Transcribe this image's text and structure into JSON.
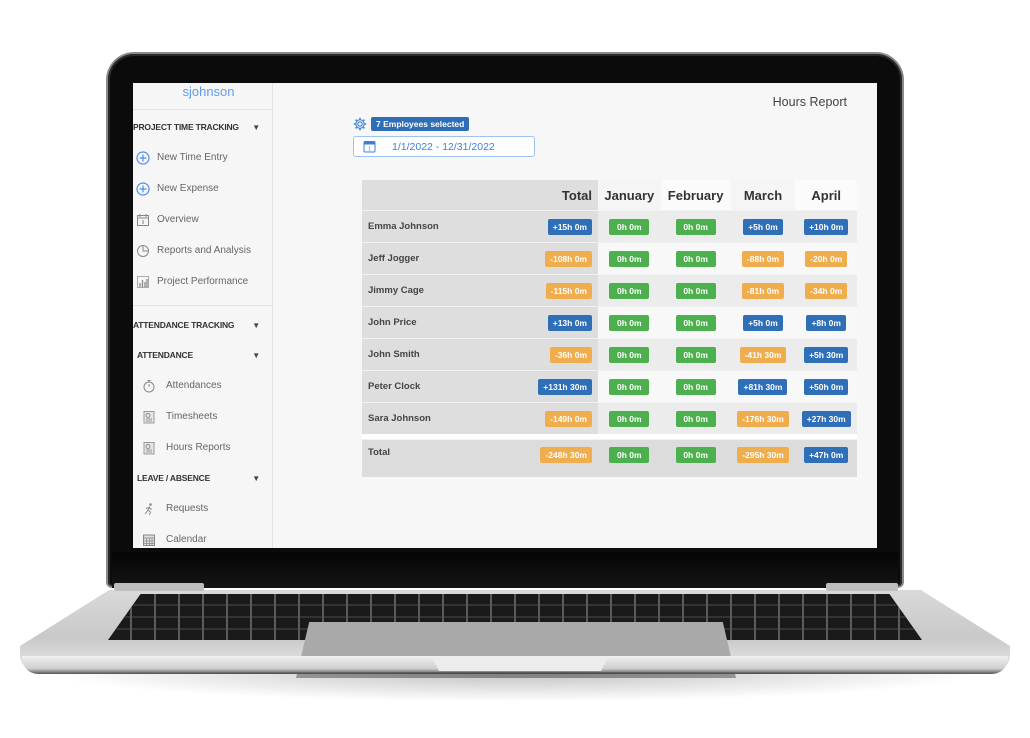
{
  "sidebar": {
    "username": "sjohnson",
    "sections": {
      "project_time_tracking": {
        "label": "PROJECT TIME TRACKING",
        "items": [
          {
            "label": "New Time Entry",
            "icon": "plus-circle-icon"
          },
          {
            "label": "New Expense",
            "icon": "plus-circle-icon"
          },
          {
            "label": "Overview",
            "icon": "calendar-icon"
          },
          {
            "label": "Reports and Analysis",
            "icon": "pie-chart-icon"
          },
          {
            "label": "Project Performance",
            "icon": "bar-chart-icon"
          }
        ]
      },
      "attendance_tracking": {
        "label": "ATTENDANCE TRACKING"
      },
      "attendance": {
        "label": "ATTENDANCE",
        "items": [
          {
            "label": "Attendances",
            "icon": "stopwatch-icon"
          },
          {
            "label": "Timesheets",
            "icon": "clipboard-clock-icon"
          },
          {
            "label": "Hours Reports",
            "icon": "clipboard-clock-icon"
          }
        ]
      },
      "leave_absence": {
        "label": "LEAVE / ABSENCE",
        "items": [
          {
            "label": "Requests",
            "icon": "running-person-icon"
          },
          {
            "label": "Calendar",
            "icon": "calendar-grid-icon"
          }
        ]
      }
    }
  },
  "main": {
    "title": "Hours Report",
    "employees_selected": "7 Employees selected",
    "date_range": "1/1/2022 - 12/31/2022"
  },
  "table": {
    "headers": {
      "name": "",
      "total": "Total",
      "months": [
        "January",
        "February",
        "March",
        "April"
      ]
    },
    "rows": [
      {
        "name": "Emma Johnson",
        "total": "+15h 0m",
        "months": [
          "0h 0m",
          "0h 0m",
          "+5h 0m",
          "+10h 0m"
        ]
      },
      {
        "name": "Jeff Jogger",
        "total": "-108h 0m",
        "months": [
          "0h 0m",
          "0h 0m",
          "-88h 0m",
          "-20h 0m"
        ]
      },
      {
        "name": "Jimmy Cage",
        "total": "-115h 0m",
        "months": [
          "0h 0m",
          "0h 0m",
          "-81h 0m",
          "-34h 0m"
        ]
      },
      {
        "name": "John Price",
        "total": "+13h 0m",
        "months": [
          "0h 0m",
          "0h 0m",
          "+5h 0m",
          "+8h 0m"
        ]
      },
      {
        "name": "John Smith",
        "total": "-36h 0m",
        "months": [
          "0h 0m",
          "0h 0m",
          "-41h 30m",
          "+5h 30m"
        ]
      },
      {
        "name": "Peter Clock",
        "total": "+131h 30m",
        "months": [
          "0h 0m",
          "0h 0m",
          "+81h 30m",
          "+50h 0m"
        ]
      },
      {
        "name": "Sara Johnson",
        "total": "-149h 0m",
        "months": [
          "0h 0m",
          "0h 0m",
          "-176h 30m",
          "+27h 30m"
        ]
      }
    ],
    "totals": {
      "label": "Total",
      "total": "-248h 30m",
      "months": [
        "0h 0m",
        "0h 0m",
        "-295h 30m",
        "+47h 0m"
      ]
    }
  },
  "colors": {
    "positive": "#2f6fb7",
    "negative": "#f0ad4e",
    "zero": "#4cb04e",
    "accent": "#3f7fd8"
  }
}
